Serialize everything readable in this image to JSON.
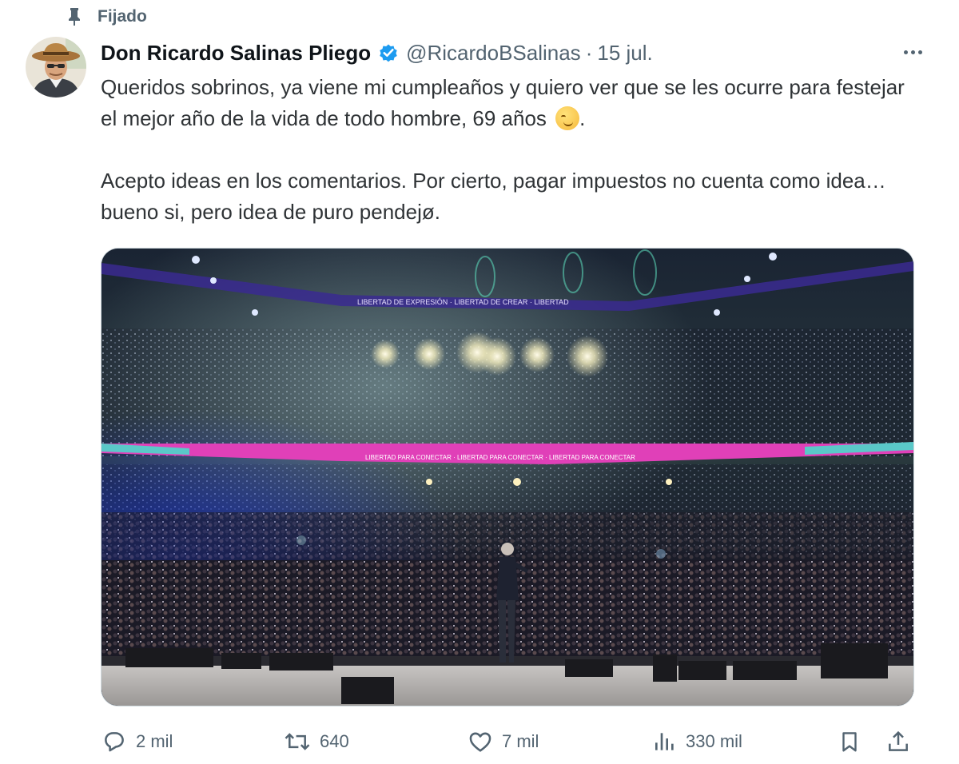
{
  "pinned": {
    "label": "Fijado",
    "icon": "pin-icon"
  },
  "author": {
    "display_name": "Don Ricardo Salinas Pliego",
    "handle": "@RicardoBSalinas",
    "separator": "·",
    "date": "15 jul.",
    "verified_color": "#1d9bf0"
  },
  "tweet": {
    "paragraph1": "Queridos sobrinos, ya viene mi cumpleaños y quiero ver que se les ocurre para festejar el mejor año de la vida de todo hombre, 69 años",
    "paragraph1_end": ".",
    "paragraph2": "Acepto ideas en los comentarios. Por cierto, pagar impuestos no cuenta como idea… bueno si, pero idea de puro pendejø."
  },
  "media": {
    "banner_upper": "LIBERTAD DE EXPRESIÓN · LIBERTAD DE CREAR · LIBERTAD",
    "banner_lower": "LIBERTAD PARA CONECTAR · LIBERTAD PARA CONECTAR · LIBERTAD PARA CONECTAR"
  },
  "actions": {
    "reply_count": "2 mil",
    "retweet_count": "640",
    "like_count": "7 mil",
    "views_count": "330 mil"
  },
  "colors": {
    "text": "#0f1419",
    "secondary": "#536471",
    "accent": "#1d9bf0"
  }
}
